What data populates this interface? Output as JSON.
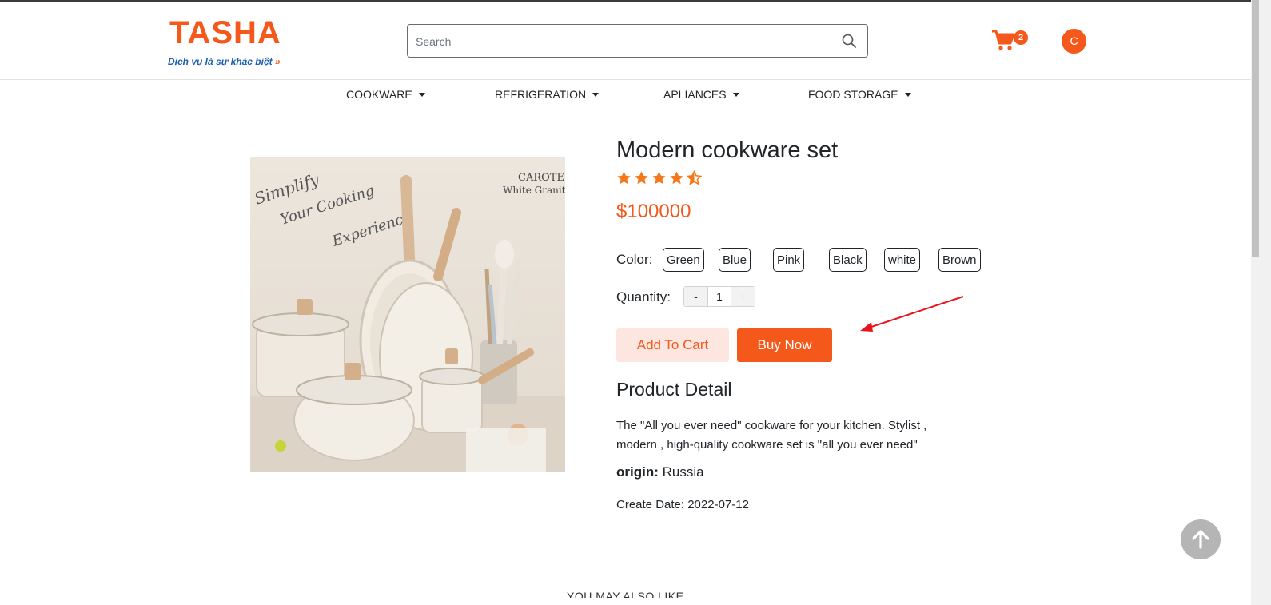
{
  "header": {
    "logo_text": "TASHA",
    "logo_tagline": "Dịch vụ là sự khác biệt",
    "logo_tagline_arrows": "»",
    "search_placeholder": "Search",
    "cart_count": "2",
    "avatar_initial": "C"
  },
  "nav": {
    "items": [
      {
        "label": "COOKWARE"
      },
      {
        "label": "REFRIGERATION"
      },
      {
        "label": "APLIANCES"
      },
      {
        "label": "FOOD STORAGE"
      }
    ]
  },
  "product": {
    "image_text": {
      "brand": "CAROTE",
      "line": "White Granite",
      "slogan1": "Simplify",
      "slogan2": "Your Cooking",
      "slogan3": "Experience"
    },
    "title": "Modern cookware set",
    "rating": 4.5,
    "rating_max": 5,
    "price": "$100000",
    "color_label": "Color:",
    "colors": [
      "Green",
      "Blue",
      "Pink",
      "Black",
      "white",
      "Brown"
    ],
    "quantity_label": "Quantity:",
    "quantity_minus": "-",
    "quantity_value": "1",
    "quantity_plus": "+",
    "add_to_cart_label": "Add To Cart",
    "buy_now_label": "Buy Now",
    "detail_heading": "Product Detail",
    "description": "The \"All you ever need\" cookware for your kitchen. Stylist , modern , high-quality cookware set is \"all you ever need\"",
    "origin_label": "origin:",
    "origin_value": "Russia",
    "create_date_label": "Create Date:",
    "create_date_value": "2022-07-12"
  },
  "also_like_heading": "YOU MAY ALSO LIKE",
  "colors": {
    "accent": "#f4581a",
    "accent_light": "#fde6df",
    "logo_blue": "#1c5fae",
    "annotation_red": "#e8141b"
  },
  "icons": {
    "search": "search-icon",
    "cart": "cart-icon",
    "star": "star-icon",
    "scroll_top": "arrow-up-icon"
  }
}
